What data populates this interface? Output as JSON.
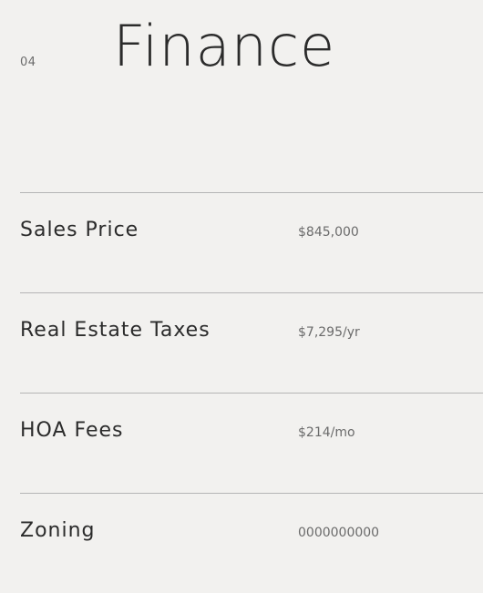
{
  "section": {
    "number": "04",
    "title": "Finance"
  },
  "rows": [
    {
      "label": "Sales Price",
      "value": "$845,000"
    },
    {
      "label": "Real Estate Taxes",
      "value": "$7,295/yr"
    },
    {
      "label": "HOA Fees",
      "value": "$214/mo"
    },
    {
      "label": "Zoning",
      "value": "0000000000"
    }
  ],
  "colors": {
    "background": "#f2f1ef",
    "text": "#2b2b2b",
    "muted": "#6b6b6b",
    "divider": "#b5b5b5"
  }
}
